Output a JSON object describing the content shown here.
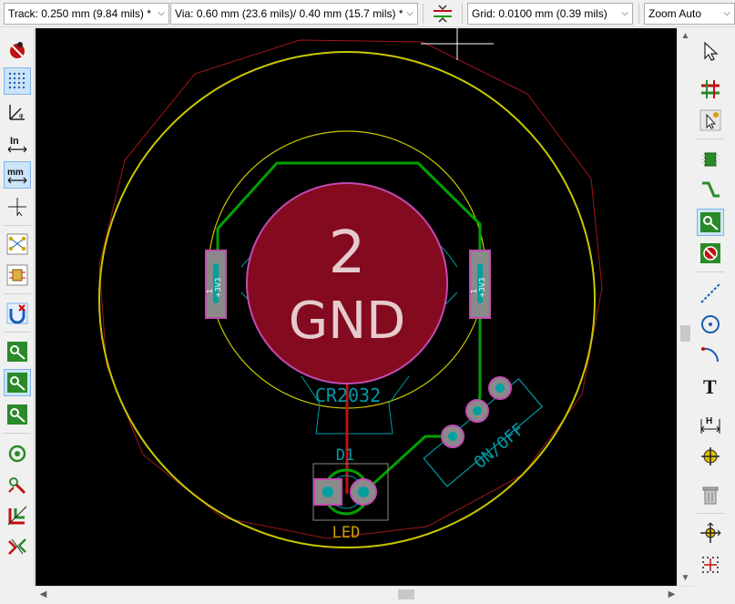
{
  "toolbar": {
    "track_select": "Track: 0.250 mm (9.84 mils) *",
    "via_select": "Via: 0.60 mm (23.6 mils)/ 0.40 mm (15.7 mils) *",
    "grid_select": "Grid: 0.0100 mm (0.39 mils)",
    "zoom_select": "Zoom Auto"
  },
  "board": {
    "battery_pad_number": "2",
    "battery_pad_net": "GND",
    "battery_ref": "CR2032",
    "smd_pad_number": "1",
    "smd_pad_net": "+3V3",
    "led_ref": "D1",
    "led_value": "LED",
    "switch_label": "ON/OFF"
  },
  "colors": {
    "canvas_bg": "#000000",
    "copper_pad": "#840a1f",
    "pad_outline": "#c24bb0",
    "track_front": "#00a000",
    "track_back": "#c01010",
    "courtyard": "#c8c800",
    "silk": "#009aa6",
    "board_edge": "#a01818"
  },
  "icons": {
    "left": [
      "drc-off-icon",
      "grid-dots-icon",
      "polar-coords-icon",
      "units-inch-icon",
      "units-mm-icon",
      "cursor-crosshair-icon",
      "ratsnest-icon",
      "module-ratsnest-icon",
      "highlight-net-icon",
      "show-pad-icon",
      "show-track-icon",
      "show-zone-icon",
      "via-outline-icon",
      "net-highlight-icon",
      "zone-fill-icon",
      "microwave-icon"
    ],
    "right": [
      "select-arrow-icon",
      "highlight-net-tool-icon",
      "local-ratsnest-icon",
      "add-footprint-icon",
      "route-track-icon",
      "route-diff-icon",
      "add-zone-icon",
      "add-line-icon",
      "add-circle-icon",
      "add-arc-icon",
      "add-text-icon",
      "add-dimension-icon",
      "add-target-icon",
      "delete-icon",
      "set-origin-icon",
      "grid-origin-icon"
    ]
  }
}
